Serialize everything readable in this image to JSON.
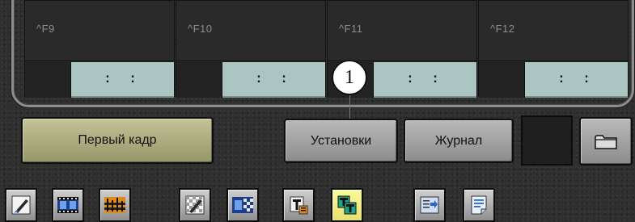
{
  "macro_slots": [
    {
      "name": "^F9",
      "timecode": ": :"
    },
    {
      "name": "^F10",
      "timecode": ": :"
    },
    {
      "name": "^F11",
      "timecode": ": :"
    },
    {
      "name": "^F12",
      "timecode": ": :"
    }
  ],
  "callout_number": "1",
  "buttons": {
    "first_frame": "Первый кадр",
    "settings": "Установки",
    "journal": "Журнал"
  },
  "toolbar_icons": [
    "brush-icon",
    "film-strip-icon",
    "audio-track-icon",
    "brush-checker-icon",
    "film-checker-icon",
    "text-title-icon",
    "text-title-double-icon",
    "export-icon",
    "notes-icon"
  ],
  "colors": {
    "background": "#2f2f2f",
    "timecode_fill": "#aac5c2",
    "first_frame_button": "#b0b083",
    "gray_button": "#a4a4a4",
    "selected_tool": "#f4ee86"
  }
}
